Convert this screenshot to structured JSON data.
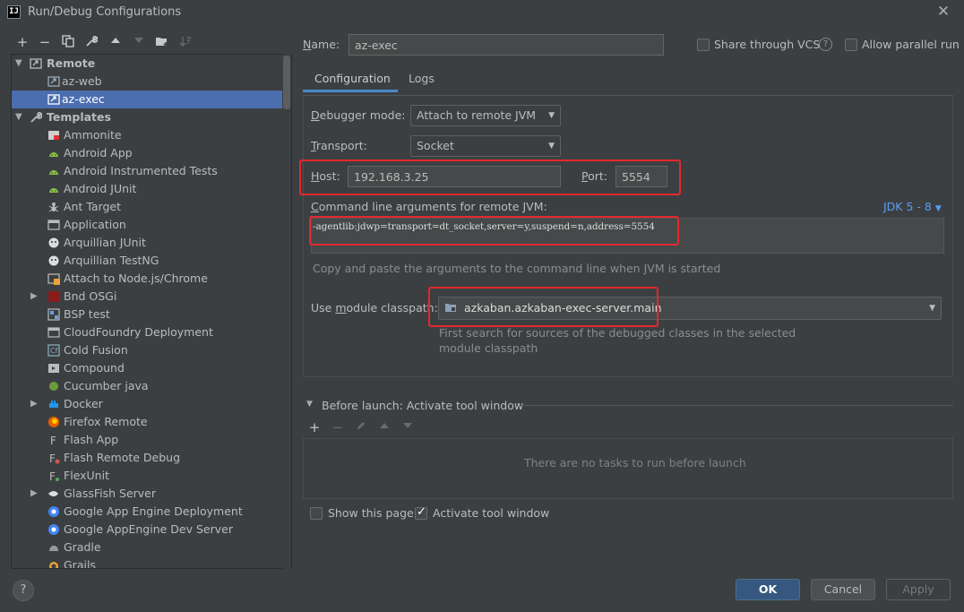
{
  "window": {
    "title": "Run/Debug Configurations",
    "app_icon": "IJ"
  },
  "toolbar": {
    "icons": [
      "plus-icon",
      "minus-icon",
      "copy-icon",
      "wrench-icon",
      "arrow-up-icon",
      "arrow-down-icon",
      "folder-icon",
      "sort-icon"
    ]
  },
  "tree": {
    "remote_label": "Remote",
    "remote_children": [
      "az-web",
      "az-exec"
    ],
    "templates_label": "Templates",
    "templates": [
      "Ammonite",
      "Android App",
      "Android Instrumented Tests",
      "Android JUnit",
      "Ant Target",
      "Application",
      "Arquillian JUnit",
      "Arquillian TestNG",
      "Attach to Node.js/Chrome",
      "Bnd OSGi",
      "BSP test",
      "CloudFoundry Deployment",
      "Cold Fusion",
      "Compound",
      "Cucumber java",
      "Docker",
      "Firefox Remote",
      "Flash App",
      "Flash Remote Debug",
      "FlexUnit",
      "GlassFish Server",
      "Google App Engine Deployment",
      "Google AppEngine Dev Server",
      "Gradle",
      "Grails"
    ]
  },
  "header": {
    "name_label": "Name:",
    "name_value": "az-exec",
    "share_label": "Share through VCS",
    "allow_parallel_label": "Allow parallel run"
  },
  "tabs": [
    {
      "label": "Configuration",
      "active": true
    },
    {
      "label": "Logs",
      "active": false
    }
  ],
  "config": {
    "debugger_mode_label": "Debugger mode:",
    "debugger_mode_value": "Attach to remote JVM",
    "transport_label": "Transport:",
    "transport_value": "Socket",
    "host_label": "Host:",
    "host_value": "192.168.3.25",
    "port_label": "Port:",
    "port_value": "5554",
    "cmd_label": "Command line arguments for remote JVM:",
    "jdk_label": "JDK 5 - 8",
    "cmd_value": "-agentlib:jdwp=transport=dt_socket,server=y,suspend=n,address=5554",
    "cmd_hint": "Copy and paste the arguments to the command line when JVM is started",
    "module_label": "Use module classpath:",
    "module_value": "azkaban.azkaban-exec-server.main",
    "module_hint_line1": "First search for sources of the debugged classes in the selected",
    "module_hint_line2": "module classpath"
  },
  "before_launch": {
    "title": "Before launch: Activate tool window",
    "empty_text": "There are no tasks to run before launch",
    "show_page_label": "Show this page",
    "activate_label": "Activate tool window"
  },
  "buttons": {
    "ok": "OK",
    "cancel": "Cancel",
    "apply": "Apply",
    "help": "?"
  },
  "colors": {
    "selection": "#4b6eaf",
    "accent_link": "#589df6",
    "highlight_red": "#e4282c"
  }
}
